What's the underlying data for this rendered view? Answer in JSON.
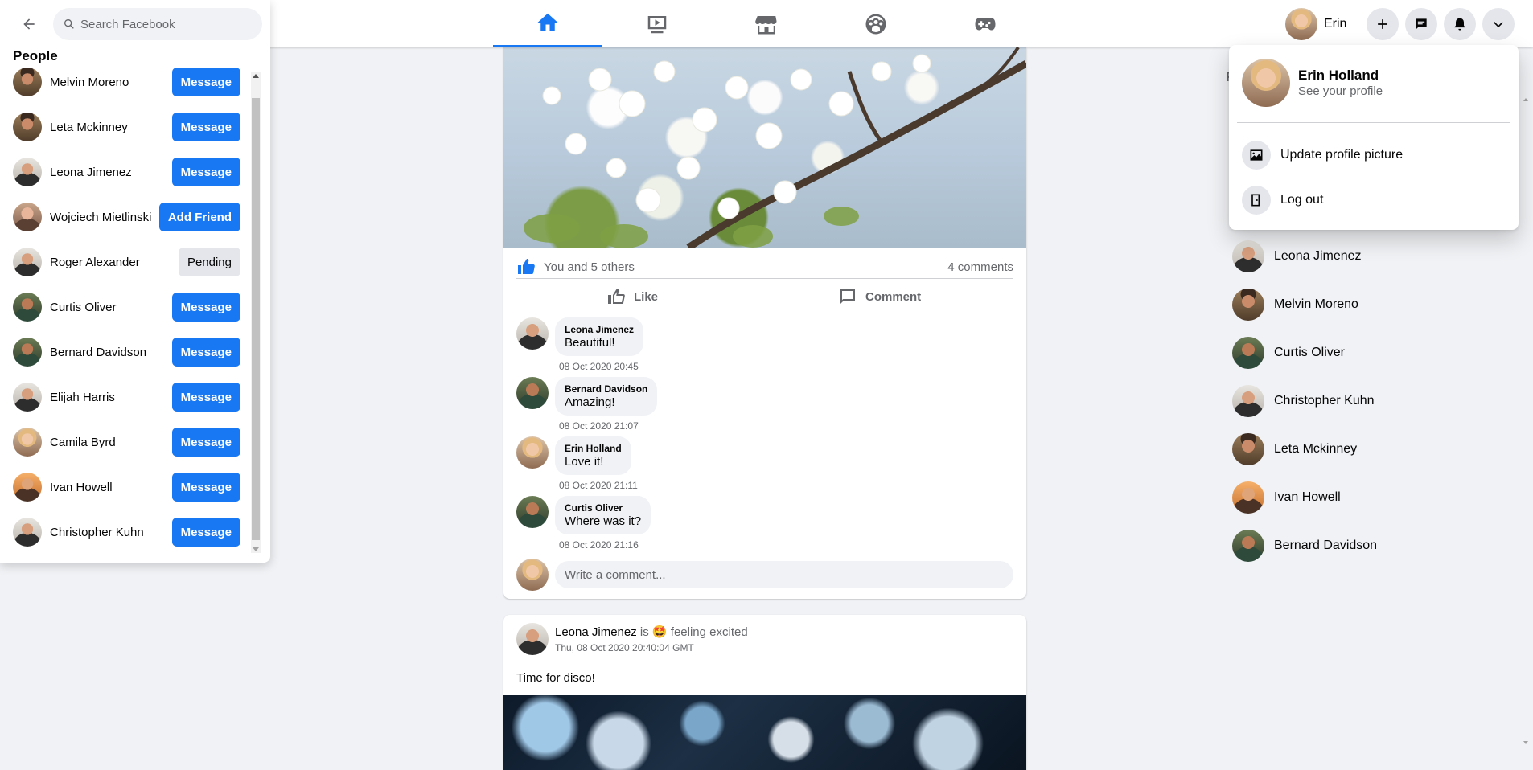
{
  "header": {
    "user_short_name": "Erin",
    "nav_tabs": [
      "home",
      "watch",
      "marketplace",
      "groups",
      "gaming"
    ],
    "active_tab": "home"
  },
  "people_panel": {
    "search_placeholder": "Search Facebook",
    "title": "People",
    "people": [
      {
        "name": "Melvin Moreno",
        "action": "Message"
      },
      {
        "name": "Leta Mckinney",
        "action": "Message"
      },
      {
        "name": "Leona Jimenez",
        "action": "Message"
      },
      {
        "name": "Wojciech Mietlinski",
        "action": "Add Friend"
      },
      {
        "name": "Roger Alexander",
        "action": "Pending"
      },
      {
        "name": "Curtis Oliver",
        "action": "Message"
      },
      {
        "name": "Bernard Davidson",
        "action": "Message"
      },
      {
        "name": "Elijah Harris",
        "action": "Message"
      },
      {
        "name": "Camila Byrd",
        "action": "Message"
      },
      {
        "name": "Ivan Howell",
        "action": "Message"
      },
      {
        "name": "Christopher Kuhn",
        "action": "Message"
      }
    ]
  },
  "post": {
    "likes_text": "You and 5 others",
    "comments_count": "4 comments",
    "like_label": "Like",
    "comment_label": "Comment",
    "comments": [
      {
        "author": "Leona Jimenez",
        "text": "Beautiful!",
        "time": "08 Oct 2020 20:45"
      },
      {
        "author": "Bernard Davidson",
        "text": "Amazing!",
        "time": "08 Oct 2020 21:07"
      },
      {
        "author": "Erin Holland",
        "text": "Love it!",
        "time": "08 Oct 2020 21:11"
      },
      {
        "author": "Curtis Oliver",
        "text": "Where was it?",
        "time": "08 Oct 2020 21:16"
      }
    ],
    "write_placeholder": "Write a comment..."
  },
  "post2": {
    "author": "Leona Jimenez",
    "feeling_prefix": "is",
    "feeling_emoji": "🤩",
    "feeling": "feeling excited",
    "timestamp": "Thu, 08 Oct 2020 20:40:04 GMT",
    "text": "Time for disco!"
  },
  "contacts": {
    "heading": "F",
    "items": [
      {
        "name": "Leona Jimenez"
      },
      {
        "name": "Melvin Moreno"
      },
      {
        "name": "Curtis Oliver"
      },
      {
        "name": "Christopher Kuhn"
      },
      {
        "name": "Leta Mckinney"
      },
      {
        "name": "Ivan Howell"
      },
      {
        "name": "Bernard Davidson"
      }
    ]
  },
  "account_menu": {
    "full_name": "Erin Holland",
    "see_profile": "See your profile",
    "items": [
      {
        "label": "Update profile picture",
        "icon": "photo-icon"
      },
      {
        "label": "Log out",
        "icon": "door-icon"
      }
    ]
  },
  "colors": {
    "accent": "#1877f2",
    "background": "#f0f2f5"
  }
}
